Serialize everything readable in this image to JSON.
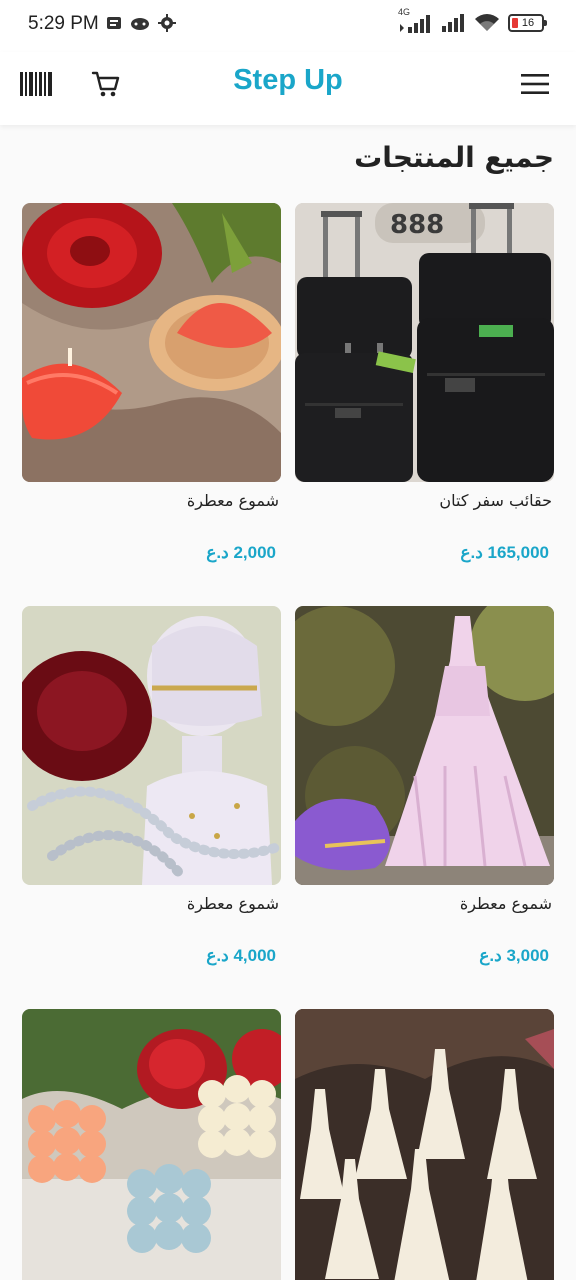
{
  "status_bar": {
    "time": "5:29 PM",
    "network": "4G",
    "battery": "16"
  },
  "header": {
    "title": "Step Up"
  },
  "section": {
    "title": "جميع المنتجات"
  },
  "currency": "د.ع",
  "products": [
    {
      "name": "حقائب سفر كتان",
      "price": "165,000"
    },
    {
      "name": "شموع معطرة",
      "price": "2,000"
    },
    {
      "name": "شموع معطرة",
      "price": "3,000"
    },
    {
      "name": "شموع معطرة",
      "price": "4,000"
    }
  ],
  "colors": {
    "accent": "#1aa6c9",
    "background": "#fafafa"
  }
}
